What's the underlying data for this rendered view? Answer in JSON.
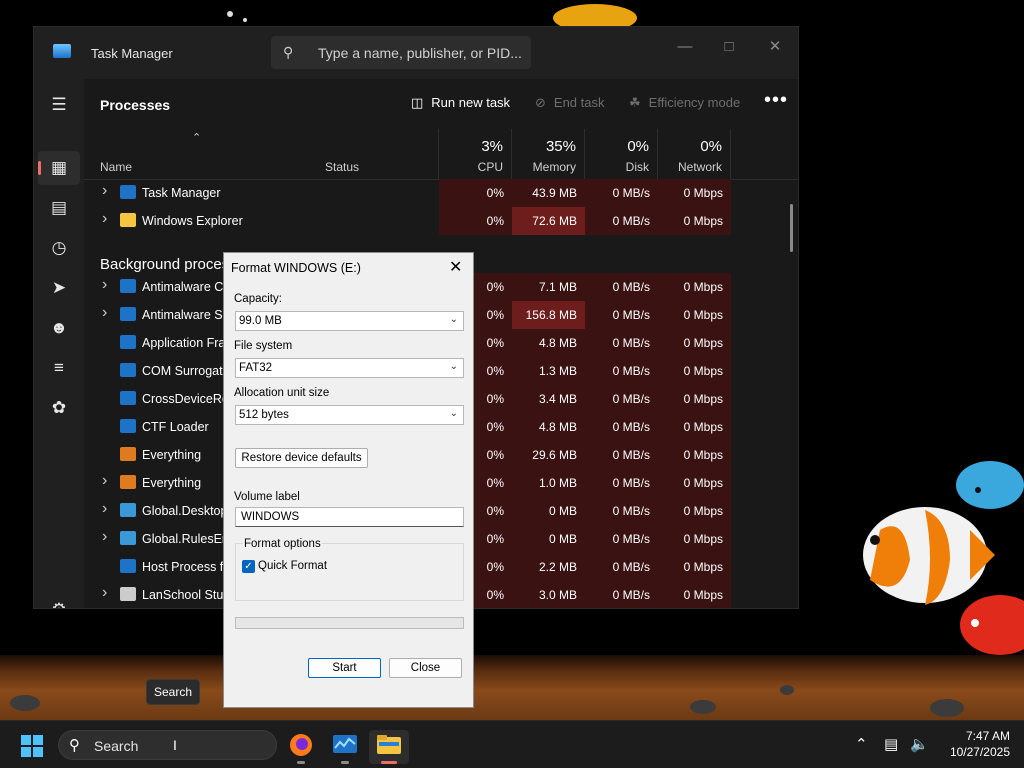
{
  "task_manager": {
    "title": "Task Manager",
    "search_placeholder": "Type a name, publisher, or PID...",
    "page_title": "Processes",
    "toolbar": {
      "run_new_task": "Run new task",
      "end_task": "End task",
      "efficiency_mode": "Efficiency mode"
    },
    "columns": {
      "name": "Name",
      "status": "Status",
      "cpu": {
        "label": "CPU",
        "pct": "3%"
      },
      "memory": {
        "label": "Memory",
        "pct": "35%"
      },
      "disk": {
        "label": "Disk",
        "pct": "0%"
      },
      "network": {
        "label": "Network",
        "pct": "0%"
      }
    },
    "background_group": "Background processes",
    "apps": [
      {
        "name": "Task Manager",
        "cpu": "0%",
        "memory": "43.9 MB",
        "disk": "0 MB/s",
        "network": "0 Mbps"
      },
      {
        "name": "Windows Explorer",
        "cpu": "0%",
        "memory": "72.6 MB",
        "disk": "0 MB/s",
        "network": "0 Mbps"
      }
    ],
    "background": [
      {
        "name": "Antimalware Core Service",
        "cpu": "0%",
        "memory": "7.1 MB",
        "disk": "0 MB/s",
        "network": "0 Mbps"
      },
      {
        "name": "Antimalware Service Executable",
        "cpu": "0%",
        "memory": "156.8 MB",
        "disk": "0 MB/s",
        "network": "0 Mbps"
      },
      {
        "name": "Application Frame Host",
        "cpu": "0%",
        "memory": "4.8 MB",
        "disk": "0 MB/s",
        "network": "0 Mbps"
      },
      {
        "name": "COM Surrogate",
        "cpu": "0%",
        "memory": "1.3 MB",
        "disk": "0 MB/s",
        "network": "0 Mbps"
      },
      {
        "name": "CrossDeviceResume",
        "cpu": "0%",
        "memory": "3.4 MB",
        "disk": "0 MB/s",
        "network": "0 Mbps"
      },
      {
        "name": "CTF Loader",
        "cpu": "0%",
        "memory": "4.8 MB",
        "disk": "0 MB/s",
        "network": "0 Mbps"
      },
      {
        "name": "Everything",
        "cpu": "0%",
        "memory": "29.6 MB",
        "disk": "0 MB/s",
        "network": "0 Mbps"
      },
      {
        "name": "Everything",
        "cpu": "0%",
        "memory": "1.0 MB",
        "disk": "0 MB/s",
        "network": "0 Mbps"
      },
      {
        "name": "Global.Desktop",
        "cpu": "0%",
        "memory": "0 MB",
        "disk": "0 MB/s",
        "network": "0 Mbps"
      },
      {
        "name": "Global.RulesEngine",
        "cpu": "0%",
        "memory": "0 MB",
        "disk": "0 MB/s",
        "network": "0 Mbps"
      },
      {
        "name": "Host Process for Windows Tasks",
        "cpu": "0%",
        "memory": "2.2 MB",
        "disk": "0 MB/s",
        "network": "0 Mbps"
      },
      {
        "name": "LanSchool Student",
        "cpu": "0%",
        "memory": "3.0 MB",
        "disk": "0 MB/s",
        "network": "0 Mbps"
      }
    ]
  },
  "format_dialog": {
    "title": "Format WINDOWS (E:)",
    "capacity_label": "Capacity:",
    "capacity_value": "99.0 MB",
    "filesystem_label": "File system",
    "filesystem_value": "FAT32",
    "allocation_label": "Allocation unit size",
    "allocation_value": "512 bytes",
    "restore_defaults": "Restore device defaults",
    "volume_label_label": "Volume label",
    "volume_label_value": "WINDOWS",
    "format_options_label": "Format options",
    "quick_format_label": "Quick Format",
    "quick_format_checked": true,
    "progress": 0,
    "start_label": "Start",
    "close_label": "Close"
  },
  "tooltip": "Search",
  "taskbar": {
    "search_text": "Search",
    "time": "7:47 AM",
    "date": "10/27/2025"
  },
  "colors": {
    "accent": "#0067c0",
    "highlight": "#e8706a",
    "heat_low": "#3a1212",
    "heat_mid": "#6e1d1d"
  }
}
